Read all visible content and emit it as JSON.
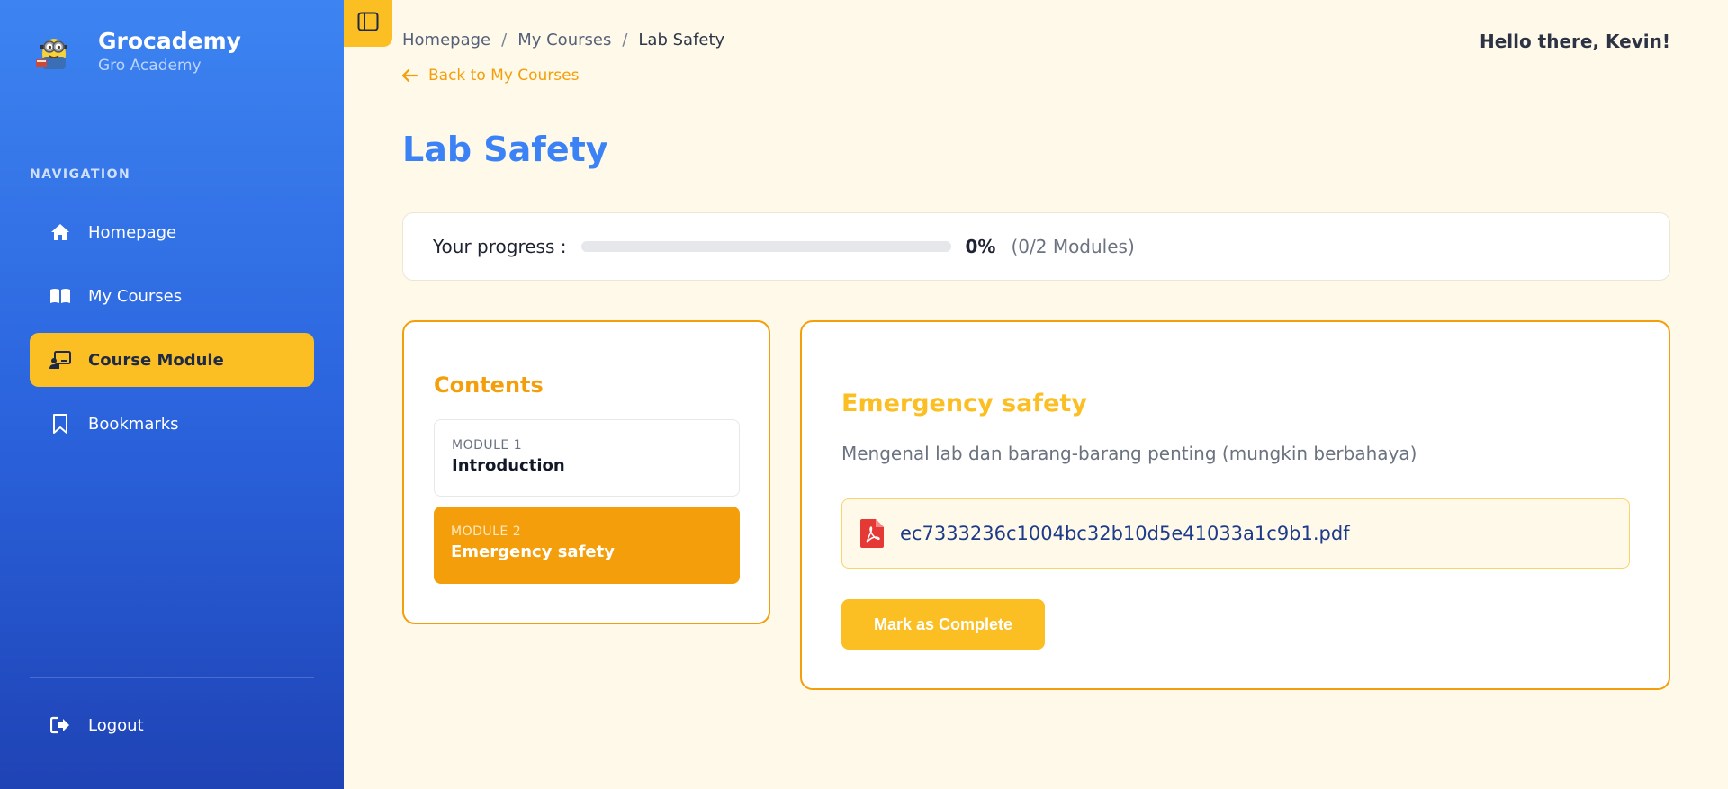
{
  "brand": {
    "name": "Grocademy",
    "subtitle": "Gro Academy",
    "logo_icon": "minion-mascot-logo"
  },
  "sidebar": {
    "heading": "NAVIGATION",
    "items": [
      {
        "label": "Homepage",
        "icon": "home-icon",
        "active": false
      },
      {
        "label": "My Courses",
        "icon": "book-open-icon",
        "active": false
      },
      {
        "label": "Course Module",
        "icon": "chalkboard-teacher-icon",
        "active": true
      },
      {
        "label": "Bookmarks",
        "icon": "bookmark-icon",
        "active": false
      }
    ],
    "logout_label": "Logout"
  },
  "header": {
    "breadcrumb": [
      "Homepage",
      "My Courses",
      "Lab Safety"
    ],
    "breadcrumb_separator": "/",
    "back_label": "Back to My Courses",
    "greeting": "Hello there, Kevin!"
  },
  "page": {
    "title": "Lab Safety"
  },
  "progress": {
    "label": "Your progress :",
    "percent_text": "0%",
    "fraction": 0,
    "count_text": "(0/2 Modules)"
  },
  "contents": {
    "title": "Contents",
    "modules": [
      {
        "label": "MODULE 1",
        "title": "Introduction",
        "active": false
      },
      {
        "label": "MODULE 2",
        "title": "Emergency safety",
        "active": true
      }
    ]
  },
  "detail": {
    "title": "Emergency safety",
    "description": "Mengenal lab dan barang-barang penting (mungkin berbahaya)",
    "file_name": "ec7333236c1004bc32b10d5e41033a1c9b1.pdf",
    "file_icon": "pdf-file-icon",
    "complete_label": "Mark as Complete"
  },
  "colors": {
    "sidebar_top": "#3d84f2",
    "sidebar_bottom": "#1f43b5",
    "accent_yellow": "#fbbf24",
    "accent_orange": "#f59e0b",
    "title_blue": "#3b82f6",
    "background": "#fef9e8",
    "pdf_red": "#e53935"
  }
}
